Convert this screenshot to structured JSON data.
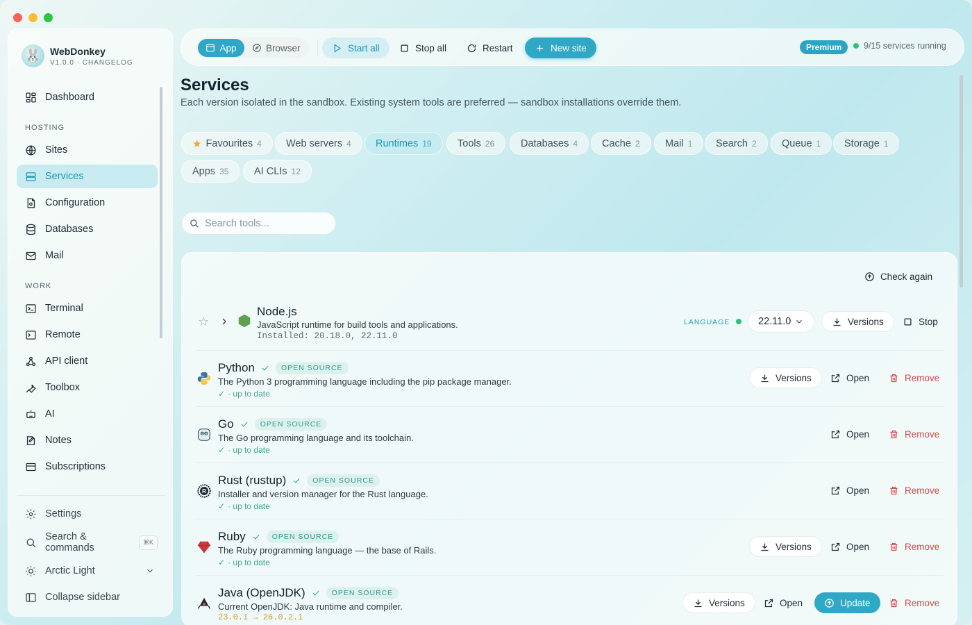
{
  "brand": {
    "name": "WebDonkey",
    "sub": "V1.0.0 · CHANGELOG"
  },
  "sidebar": {
    "top": [
      {
        "label": "Dashboard",
        "icon": "dashboard-icon"
      }
    ],
    "sections": [
      {
        "label": "HOSTING",
        "items": [
          {
            "label": "Sites",
            "icon": "globe-icon"
          },
          {
            "label": "Services",
            "icon": "server-icon",
            "active": true
          },
          {
            "label": "Configuration",
            "icon": "file-cog-icon"
          },
          {
            "label": "Databases",
            "icon": "database-icon"
          },
          {
            "label": "Mail",
            "icon": "mail-icon"
          }
        ]
      },
      {
        "label": "WORK",
        "items": [
          {
            "label": "Terminal",
            "icon": "terminal-icon"
          },
          {
            "label": "Remote",
            "icon": "remote-terminal-icon"
          },
          {
            "label": "API client",
            "icon": "api-icon"
          },
          {
            "label": "Toolbox",
            "icon": "wrench-icon"
          },
          {
            "label": "AI",
            "icon": "robot-icon"
          },
          {
            "label": "Notes",
            "icon": "notes-icon"
          },
          {
            "label": "Subscriptions",
            "icon": "card-icon"
          }
        ]
      }
    ],
    "bottom": {
      "settings": "Settings",
      "search": "Search & commands",
      "search_kbd": "⌘K",
      "theme": "Arctic Light",
      "collapse": "Collapse sidebar"
    }
  },
  "toolbar": {
    "app": "App",
    "browser": "Browser",
    "start_all": "Start all",
    "stop_all": "Stop all",
    "restart": "Restart",
    "new_site": "New site",
    "premium": "Premium",
    "status": "9/15 services running"
  },
  "header": {
    "title": "Services",
    "description": "Each version isolated in the sandbox. Existing system tools are preferred — sandbox installations override them."
  },
  "chips": [
    {
      "label": "Favourites",
      "count": "4",
      "star": true
    },
    {
      "label": "Web servers",
      "count": "4"
    },
    {
      "label": "Runtimes",
      "count": "19",
      "active": true
    },
    {
      "label": "Tools",
      "count": "26"
    },
    {
      "label": "Databases",
      "count": "4"
    },
    {
      "label": "Cache",
      "count": "2"
    },
    {
      "label": "Mail",
      "count": "1"
    },
    {
      "label": "Search",
      "count": "2"
    },
    {
      "label": "Queue",
      "count": "1"
    },
    {
      "label": "Storage",
      "count": "1"
    },
    {
      "label": "Apps",
      "count": "35"
    },
    {
      "label": "AI CLIs",
      "count": "12"
    }
  ],
  "search": {
    "placeholder": "Search tools..."
  },
  "panel": {
    "check_again": "Check again",
    "labels": {
      "language": "LANGUAGE",
      "versions": "Versions",
      "stop": "Stop",
      "open": "Open",
      "remove": "Remove",
      "update": "Update",
      "open_source": "OPEN SOURCE",
      "up_to_date": "· up to date"
    },
    "node": {
      "name": "Node.js",
      "desc": "JavaScript runtime for build tools and applications.",
      "installed": "Installed: 20.18.0, 22.11.0",
      "version": "22.11.0"
    },
    "tools": [
      {
        "name": "Python",
        "desc": "The Python 3 programming language including the pip package manager.",
        "versions": true,
        "logo": "python-logo-icon"
      },
      {
        "name": "Go",
        "desc": "The Go programming language and its toolchain.",
        "versions": false,
        "logo": "go-gopher-icon"
      },
      {
        "name": "Rust (rustup)",
        "desc": "Installer and version manager for the Rust language.",
        "versions": false,
        "logo": "rust-logo-icon"
      },
      {
        "name": "Ruby",
        "desc": "The Ruby programming language — the base of Rails.",
        "versions": true,
        "logo": "ruby-gem-icon"
      },
      {
        "name": "Java (OpenJDK)",
        "desc": "Current OpenJDK: Java runtime and compiler.",
        "versions": true,
        "update": true,
        "update_text": "23.0.1 → 26.0.2.1",
        "logo": "java-duke-icon"
      }
    ]
  }
}
